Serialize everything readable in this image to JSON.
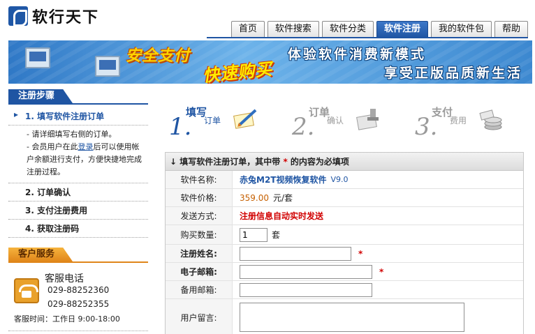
{
  "logo": {
    "text": "软行天下"
  },
  "nav": {
    "tabs": [
      {
        "label": "首页"
      },
      {
        "label": "软件搜索"
      },
      {
        "label": "软件分类"
      },
      {
        "label": "软件注册"
      },
      {
        "label": "我的软件包"
      },
      {
        "label": "帮助"
      }
    ],
    "active_index": 3
  },
  "banner": {
    "slogan_1": "安全支付",
    "slogan_2": "快速购买",
    "slogan_3": "体验软件消费新模式",
    "slogan_4": "享受正版品质新生活"
  },
  "sidebar": {
    "steps_title": "注册步骤",
    "steps": [
      {
        "label": "1. 填写软件注册订单"
      },
      {
        "label": "2. 订单确认"
      },
      {
        "label": "3. 支付注册费用"
      },
      {
        "label": "4. 获取注册码"
      }
    ],
    "step1_desc_line1": "- 请详细填写右侧的订单。",
    "step1_desc_line2_pre": "- 会员用户在此",
    "step1_desc_link": "登录",
    "step1_desc_line2_post": "后可以使用帐户余额进行支付，方便快捷地完成注册过程。",
    "service_title": "客户服务",
    "service_phone_label": "客服电话",
    "phone_1": "029-88252360",
    "phone_2": "029-88252355",
    "hours": "客服时间：工作日 9:00-18:00"
  },
  "flow": [
    {
      "num": "1.",
      "top": "填写",
      "bottom": "订单"
    },
    {
      "num": "2.",
      "top": "订单",
      "bottom": "确认"
    },
    {
      "num": "3.",
      "top": "支付",
      "bottom": "费用"
    }
  ],
  "form": {
    "header_pre": "填写软件注册订单，其中带",
    "header_star": "*",
    "header_post": "的内容为必填项",
    "software_name_label": "软件名称:",
    "software_name": "赤兔M2T视频恢复软件",
    "software_version": "V9.0",
    "price_label": "软件价格:",
    "price": "359.00",
    "price_unit": "元/套",
    "delivery_label": "发送方式:",
    "delivery": "注册信息自动实时发送",
    "qty_label": "购买数量:",
    "qty_value": "1",
    "qty_unit": "套",
    "reg_name_label": "注册姓名:",
    "email_label": "电子邮箱:",
    "backup_email_label": "备用邮箱:",
    "message_label": "用户留言:",
    "required_mark": "*"
  },
  "colors": {
    "brand_blue": "#1f55a3",
    "required_red": "#d10000",
    "price_orange": "#c66000",
    "service_orange": "#e0861a"
  }
}
